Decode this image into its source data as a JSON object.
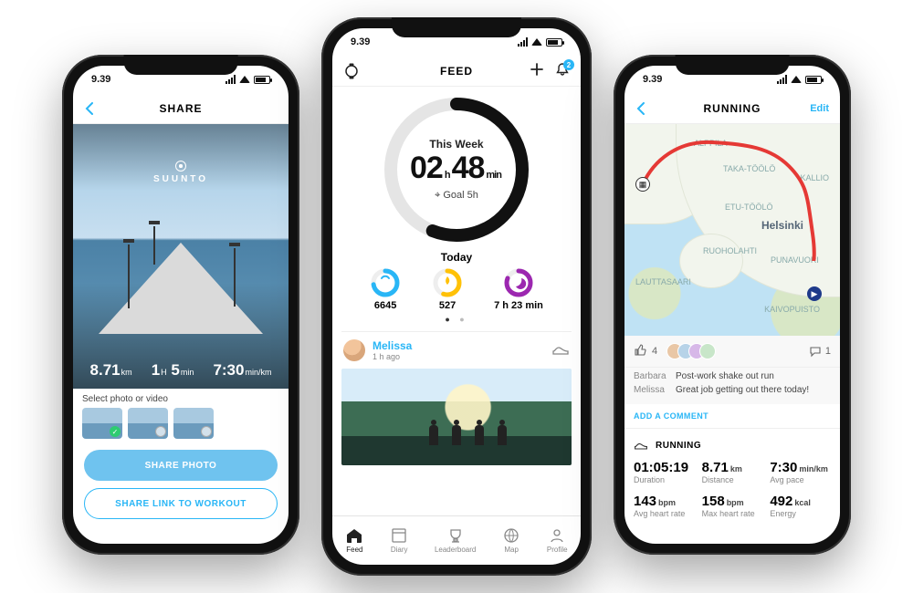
{
  "accent": "#29B6F6",
  "statusbar": {
    "time": "9.39"
  },
  "phone1": {
    "title": "SHARE",
    "brand": "SUUNTO",
    "photoStats": {
      "distance": {
        "value": "8.71",
        "unit": "km"
      },
      "duration": {
        "hours": "1",
        "h_unit": "H",
        "mins": "5",
        "m_unit": "min"
      },
      "pace": {
        "value": "7:30",
        "unit": "min/km"
      }
    },
    "selectLabel": "Select photo or video",
    "primaryCta": "SHARE PHOTO",
    "secondaryCta": "SHARE LINK TO WORKOUT"
  },
  "phone2": {
    "title": "FEED",
    "notificationCount": "2",
    "ring": {
      "label": "This Week",
      "hours": "02",
      "h_unit": "h",
      "mins": "48",
      "m_unit": "min",
      "goal": "Goal 5h",
      "progress": 0.56
    },
    "todayLabel": "Today",
    "minis": {
      "steps": {
        "value": "6645",
        "progress": 0.72,
        "color": "#29B6F6"
      },
      "cal": {
        "value": "527",
        "progress": 0.55,
        "color": "#FFC107"
      },
      "sleep": {
        "value": "7 h 23 min",
        "progress": 0.8,
        "color": "#9C27B0"
      }
    },
    "feed": {
      "name": "Melissa",
      "time": "1 h ago"
    },
    "tabs": [
      "Feed",
      "Diary",
      "Leaderboard",
      "Map",
      "Profile"
    ]
  },
  "phone3": {
    "title": "RUNNING",
    "edit": "Edit",
    "mapLabels": {
      "city": "Helsinki",
      "n1": "ALPPILA",
      "n2": "TAKA-TÖÖLÖ",
      "n3": "ETU-TÖÖLÖ",
      "n4": "RUOHOLAHTI",
      "n5": "PUNAVUORI",
      "n6": "LAUTTASAARI",
      "n7": "KALLIO",
      "n8": "KAIVOPUISTO"
    },
    "social": {
      "likes": "4",
      "comments": "1"
    },
    "commentsList": [
      {
        "who": "Barbara",
        "text": "Post-work shake out run"
      },
      {
        "who": "Melissa",
        "text": "Great job getting out there today!"
      }
    ],
    "addComment": "ADD A COMMENT",
    "activityLabel": "RUNNING",
    "stats": {
      "duration": {
        "v": "01:05:19",
        "u": "",
        "l": "Duration"
      },
      "distance": {
        "v": "8.71",
        "u": "km",
        "l": "Distance"
      },
      "pace": {
        "v": "7:30",
        "u": "min/km",
        "l": "Avg pace"
      },
      "avgHr": {
        "v": "143",
        "u": "bpm",
        "l": "Avg heart rate"
      },
      "maxHr": {
        "v": "158",
        "u": "bpm",
        "l": "Max heart rate"
      },
      "energy": {
        "v": "492",
        "u": "kcal",
        "l": "Energy"
      }
    }
  }
}
